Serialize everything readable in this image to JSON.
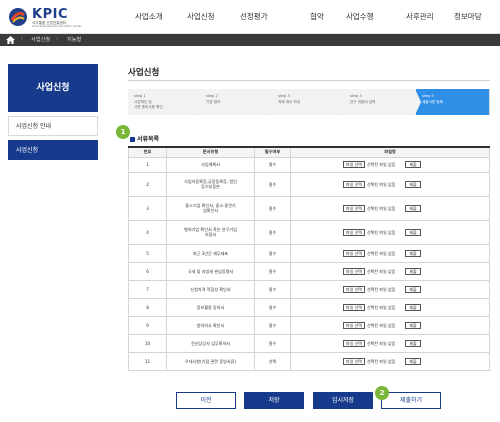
{
  "header": {
    "brand": "KPIC",
    "brand_sub1": "국가통합 산업진흥센터",
    "brand_sub2": "Korea Business Info Innovation Center",
    "nav": [
      "사업소개",
      "사업신청",
      "선정평가",
      "협약",
      "사업수행",
      "사후관리",
      "정보마당"
    ]
  },
  "breadcrumb": [
    "사업신청",
    "지능형"
  ],
  "sidebar": {
    "title": "사업신청",
    "items": [
      {
        "label": "사업신청 안내",
        "active": false
      },
      {
        "label": "사업신청",
        "active": true
      }
    ]
  },
  "main": {
    "title": "사업신청",
    "steps": [
      {
        "num": "step 1",
        "title": "사업확인 및",
        "title2": "서면 준비사항 확인",
        "active": false
      },
      {
        "num": "step 2",
        "title": "기업 정보",
        "title2": "",
        "active": false
      },
      {
        "num": "step 3",
        "title": "과제 개요 작성",
        "title2": "",
        "active": false
      },
      {
        "num": "step 4",
        "title": "연구 개발비 입력",
        "title2": "",
        "active": false
      },
      {
        "num": "step 5",
        "title": "제출서류 등록",
        "title2": "",
        "active": true
      }
    ],
    "badge1": "1",
    "badge2": "2",
    "section_title": "서류목록",
    "table": {
      "headers": [
        "번호",
        "문서유형",
        "필수여부",
        "파일명"
      ],
      "file_button": "파일 선택",
      "file_status": "선택된 파일 없음",
      "submit_button": "제출",
      "rows": [
        {
          "no": "1",
          "type": "사업계획서",
          "type2": "",
          "req": "필수"
        },
        {
          "no": "2",
          "type": "사업자등록증,공장등록증, 법인",
          "type2": "등기부등본",
          "req": "필수"
        },
        {
          "no": "3",
          "type": "중소기업 확인서, 중소·중견기",
          "type2": "업확인서",
          "req": "필수"
        },
        {
          "no": "4",
          "type": "벤처기업 확인서 혹은 연구기업",
          "type2": "지정서",
          "req": "필수"
        },
        {
          "no": "5",
          "type": "최근 3년간 재무제표",
          "type2": "",
          "req": "필수"
        },
        {
          "no": "6",
          "type": "국세 및 지방세 완납증명서",
          "type2": "",
          "req": "필수"
        },
        {
          "no": "7",
          "type": "신청자격 적합성 확인서",
          "type2": "",
          "req": "필수"
        },
        {
          "no": "8",
          "type": "정보활용 동의서",
          "type2": "",
          "req": "필수"
        },
        {
          "no": "9",
          "type": "청약의사 확인서",
          "type2": "",
          "req": "필수"
        },
        {
          "no": "10",
          "type": "전산담당자 임무확약서",
          "type2": "",
          "req": "필수"
        },
        {
          "no": "11",
          "type": "우대사항(가점 관련 증빙서류)",
          "type2": "",
          "req": "선택"
        }
      ]
    },
    "buttons": {
      "prev": "이전",
      "save": "저장",
      "temp_save": "임시저장",
      "submit": "제출하기"
    }
  },
  "colors": {
    "primary": "#173a8c",
    "active_step": "#2f8fe6",
    "badge": "#79b63a"
  }
}
